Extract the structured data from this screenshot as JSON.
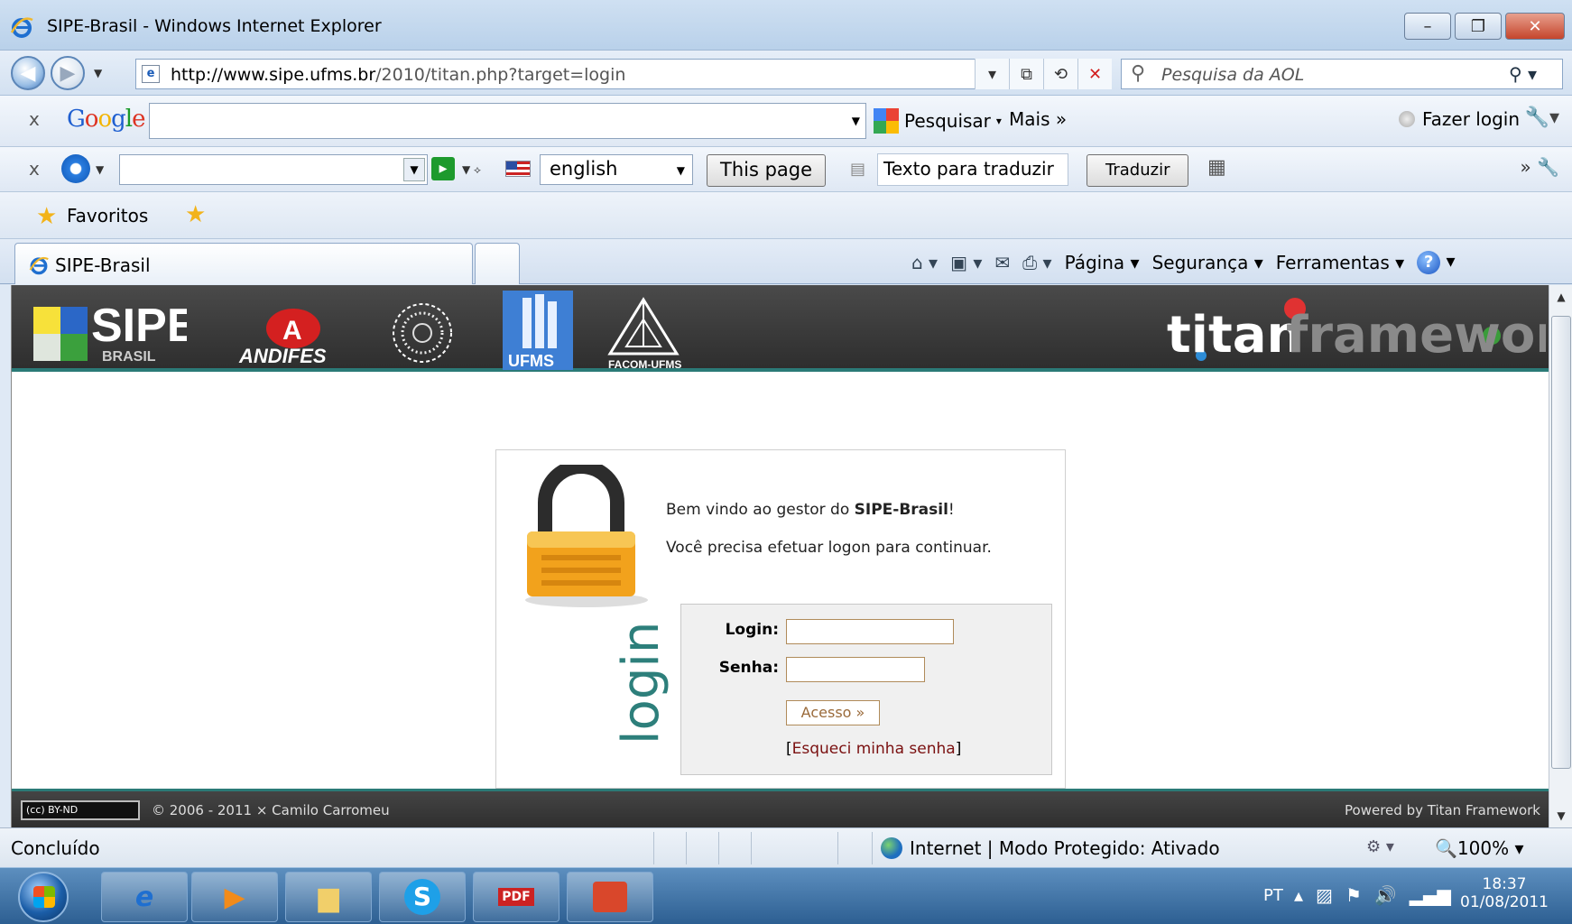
{
  "window": {
    "title": "SIPE-Brasil - Windows Internet Explorer",
    "minimize": "–",
    "restore": "❐",
    "close": "✕"
  },
  "address_bar": {
    "url_host": "http://www.sipe.ufms.br",
    "url_path": "/2010/titan.php?target=login",
    "search_placeholder": "Pesquisa da AOL"
  },
  "google_toolbar": {
    "logo": "Google",
    "search_label": "Pesquisar",
    "more_label": "Mais »",
    "login_label": "Fazer login"
  },
  "translate_toolbar": {
    "language": "english",
    "this_page": "This page",
    "translate_input_value": "Texto para traduzir",
    "translate_button": "Traduzir"
  },
  "favorites_bar": {
    "label": "Favoritos"
  },
  "tab": {
    "label": "SIPE-Brasil"
  },
  "command_bar": {
    "page": "Página ▾",
    "security": "Segurança ▾",
    "tools": "Ferramentas ▾"
  },
  "header": {
    "logo_sipe": "SIPE",
    "logo_sipe_sub": "BRASIL",
    "logo_andifes": "ANDIFES",
    "logo_ufms": "UFMS",
    "logo_facom": "FACOM-UFMS",
    "logo_titan_a": "titan",
    "logo_titan_b": "framework"
  },
  "login_box": {
    "welcome_prefix": "Bem vindo ao gestor do ",
    "welcome_name": "SIPE-Brasil",
    "welcome_suffix": "!",
    "instruction": "Você precisa efetuar logon para continuar.",
    "vertical_label": "login",
    "login_label": "Login:",
    "login_value": "",
    "password_label": "Senha:",
    "password_value": "",
    "submit": "Acesso »",
    "forgot_open": "[",
    "forgot": "Esqueci minha senha",
    "forgot_close": "]"
  },
  "footer": {
    "license": "(cc) BY-ND",
    "copyright": "© 2006 - 2011 × Camilo Carromeu",
    "powered": "Powered by Titan Framework"
  },
  "status_bar": {
    "status": "Concluído",
    "zone": "Internet | Modo Protegido: Ativado",
    "zoom": "🔍100%  ▾"
  },
  "taskbar": {
    "language": "PT",
    "time": "18:37",
    "date": "01/08/2011"
  }
}
